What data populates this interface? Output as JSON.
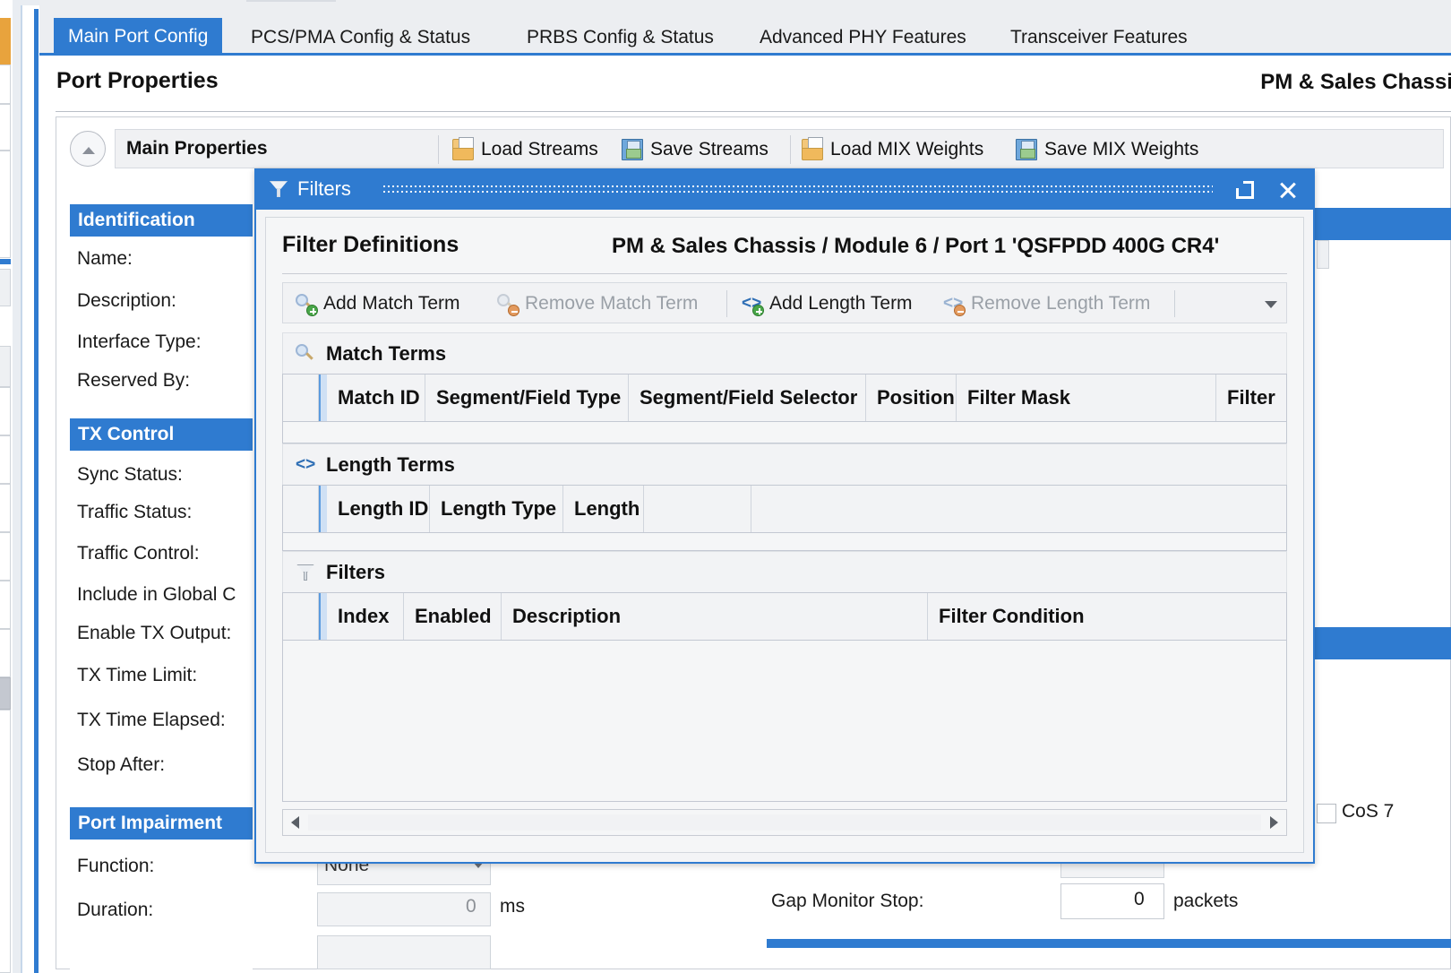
{
  "tabs": [
    {
      "label": "Main Port Config",
      "active": true
    },
    {
      "label": "PCS/PMA Config & Status",
      "active": false
    },
    {
      "label": "PRBS Config & Status",
      "active": false
    },
    {
      "label": "Advanced PHY Features",
      "active": false
    },
    {
      "label": "Transceiver Features",
      "active": false
    }
  ],
  "page": {
    "title": "Port Properties",
    "title_right": "PM & Sales Chassi"
  },
  "toolbar": {
    "group_label": "Main Properties",
    "items": [
      {
        "label": "Load Streams",
        "icon": "folder-open-icon"
      },
      {
        "label": "Save Streams",
        "icon": "floppy-disk-icon"
      },
      {
        "label": "Load MIX Weights",
        "icon": "folder-open-icon"
      },
      {
        "label": "Save MIX Weights",
        "icon": "floppy-disk-icon"
      }
    ]
  },
  "properties_panel": {
    "sections": [
      {
        "header": "Identification",
        "fields": [
          "Name:",
          "Description:",
          "Interface Type:",
          "Reserved By:"
        ]
      },
      {
        "header": "TX Control",
        "fields": [
          "Sync Status:",
          "Traffic Status:",
          "Traffic Control:",
          "Include in Global C",
          "Enable TX Output:",
          "TX Time Limit:",
          "TX Time Elapsed:",
          "Stop After:"
        ]
      },
      {
        "header": "Port Impairment",
        "fields": [
          "Function:",
          "Duration:"
        ]
      }
    ],
    "values": {
      "function": "None",
      "duration": "0",
      "duration_unit": "ms",
      "gap_monitor_stop_label": "Gap Monitor Stop:",
      "gap_monitor_stop": "0",
      "gap_monitor_stop_unit": "packets",
      "cos_label": "CoS 7"
    }
  },
  "dialog": {
    "title": "Filters",
    "title_icon": "funnel-icon",
    "maximize_icon": "maximize-icon",
    "close_icon": "close-icon",
    "heading": "Filter Definitions",
    "heading_right": "PM & Sales Chassis / Module 6 / Port 1 'QSFPDD 400G CR4'",
    "commands": [
      {
        "label": "Add Match Term",
        "icon": "magnifier-add-icon",
        "enabled": true
      },
      {
        "label": "Remove Match Term",
        "icon": "magnifier-remove-icon",
        "enabled": false
      },
      {
        "label": "Add Length Term",
        "icon": "angle-brackets-add-icon",
        "enabled": true
      },
      {
        "label": "Remove Length Term",
        "icon": "angle-brackets-remove-icon",
        "enabled": false
      }
    ],
    "overflow_icon": "chevron-down-icon",
    "sections": [
      {
        "name": "Match Terms",
        "icon": "magnifier-icon",
        "columns": [
          "Match ID",
          "Segment/Field Type",
          "Segment/Field Selector",
          "Position",
          "Filter Mask",
          "Filter"
        ],
        "rows": []
      },
      {
        "name": "Length Terms",
        "icon": "angle-brackets-icon",
        "columns": [
          "Length ID",
          "Length Type",
          "Length"
        ],
        "rows": []
      },
      {
        "name": "Filters",
        "icon": "funnel-icon",
        "columns": [
          "Index",
          "Enabled",
          "Description",
          "Filter Condition"
        ],
        "rows": []
      }
    ],
    "scrollbar": {
      "left_arrow_icon": "arrow-left-icon",
      "right_arrow_icon": "arrow-right-icon"
    }
  }
}
